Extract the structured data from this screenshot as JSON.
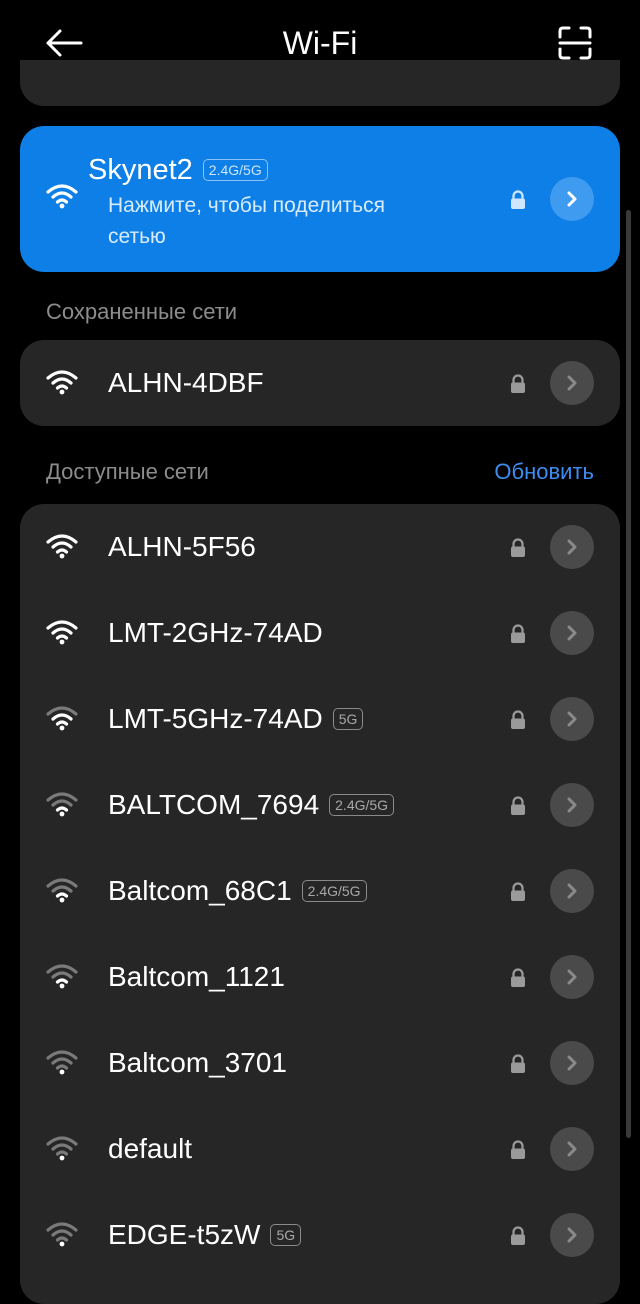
{
  "header": {
    "title": "Wi-Fi",
    "back_icon": "arrow-left-icon",
    "scan_icon": "qr-scan-icon"
  },
  "connected": {
    "name": "Skynet2",
    "band": "2.4G/5G",
    "subtitle": "Нажмите, чтобы поделиться сетью",
    "secured": true,
    "signal": 4,
    "accent": "#0d7fe6"
  },
  "saved": {
    "label": "Сохраненные сети",
    "networks": [
      {
        "name": "ALHN-4DBF",
        "band": "",
        "secured": true,
        "signal": 4
      }
    ]
  },
  "available": {
    "label": "Доступные сети",
    "refresh_label": "Обновить",
    "networks": [
      {
        "name": "ALHN-5F56",
        "band": "",
        "secured": true,
        "signal": 4
      },
      {
        "name": "LMT-2GHz-74AD",
        "band": "",
        "secured": true,
        "signal": 4
      },
      {
        "name": "LMT-5GHz-74AD",
        "band": "5G",
        "secured": true,
        "signal": 3
      },
      {
        "name": "BALTCOM_7694",
        "band": "2.4G/5G",
        "secured": true,
        "signal": 2
      },
      {
        "name": "Baltcom_68C1",
        "band": "2.4G/5G",
        "secured": true,
        "signal": 2
      },
      {
        "name": "Baltcom_1121",
        "band": "",
        "secured": true,
        "signal": 2
      },
      {
        "name": "Baltcom_3701",
        "band": "",
        "secured": true,
        "signal": 1
      },
      {
        "name": "default",
        "band": "",
        "secured": true,
        "signal": 1
      },
      {
        "name": "EDGE-t5zW",
        "band": "5G",
        "secured": true,
        "signal": 1
      }
    ]
  }
}
